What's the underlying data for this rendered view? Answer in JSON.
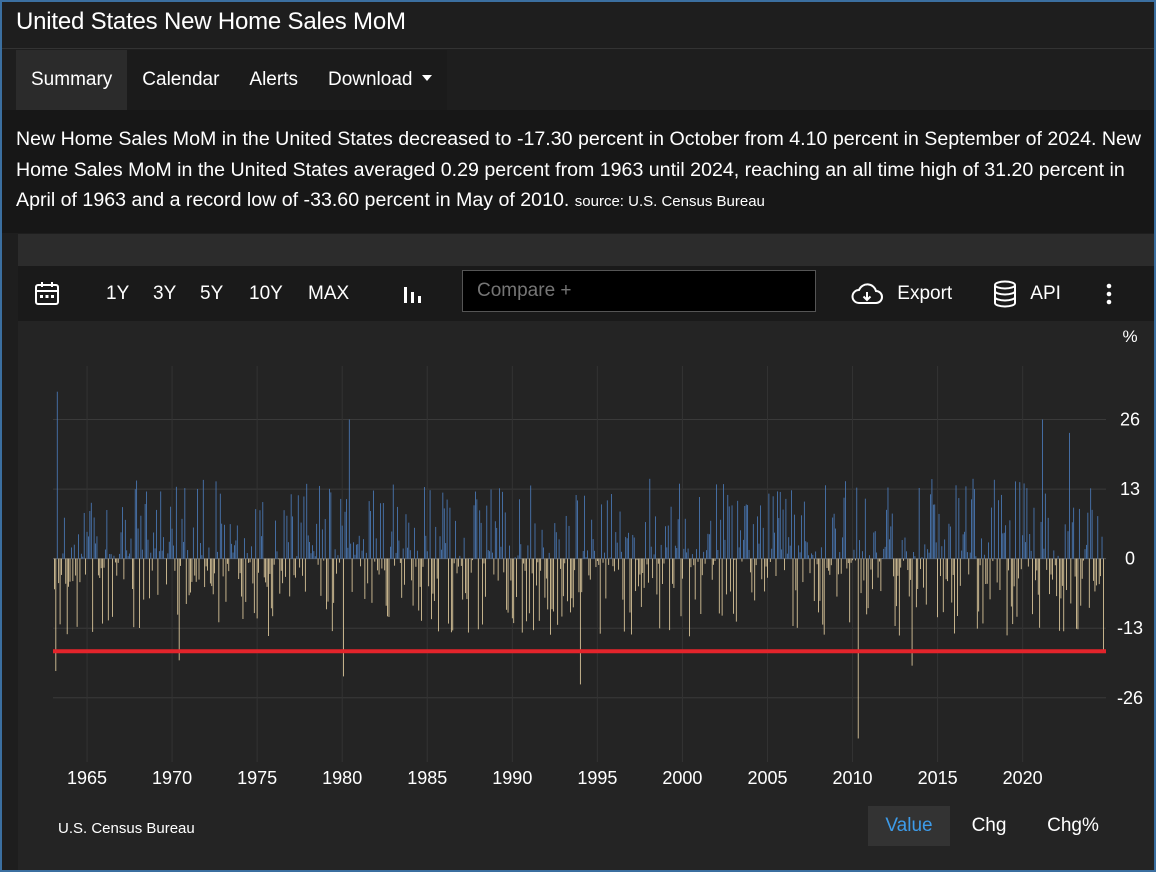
{
  "header": {
    "title": "United States New Home Sales MoM"
  },
  "tabs": [
    {
      "label": "Summary"
    },
    {
      "label": "Calendar"
    },
    {
      "label": "Alerts"
    },
    {
      "label": "Download"
    }
  ],
  "description": {
    "text": "New Home Sales MoM in the United States decreased to -17.30 percent in October from 4.10 percent in September of 2024. New Home Sales MoM in the United States averaged 0.29 percent from 1963 until 2024, reaching an all time high of 31.20 percent in April of 1963 and a record low of -33.60 percent in May of 2010.",
    "source": "source: U.S. Census Bureau"
  },
  "toolbar": {
    "ranges": [
      "1Y",
      "3Y",
      "5Y",
      "10Y",
      "MAX"
    ],
    "compare_placeholder": "Compare +",
    "export_label": "Export",
    "api_label": "API"
  },
  "chart_footer": {
    "source": "U.S. Census Bureau",
    "buttons": [
      "Value",
      "Chg",
      "Chg%"
    ],
    "active": "Value"
  },
  "colors": {
    "positive": "#4e81c4",
    "negative": "#f0d9a8",
    "reference_line": "#e3242b",
    "accent": "#3d9be9"
  },
  "chart_data": {
    "type": "bar",
    "unit_label": "%",
    "x_ticks": [
      "1965",
      "1970",
      "1975",
      "1980",
      "1985",
      "1990",
      "1995",
      "2000",
      "2005",
      "2010",
      "2015",
      "2020"
    ],
    "y_ticks": [
      26,
      13,
      0,
      -13,
      -26
    ],
    "ylim": [
      -38,
      36
    ],
    "xlim": [
      1963.0,
      2024.9
    ],
    "reference_line": -17.3,
    "grid": true,
    "notable_points": [
      {
        "date": "1963-04",
        "value": 31.2
      },
      {
        "date": "1963-03",
        "value": -21.0
      },
      {
        "date": "1970-06",
        "value": -19.0
      },
      {
        "date": "1980-06",
        "value": 26.0
      },
      {
        "date": "1980-02",
        "value": -22.0
      },
      {
        "date": "1994-01",
        "value": -23.5
      },
      {
        "date": "2010-05",
        "value": -33.6
      },
      {
        "date": "2013-07",
        "value": -20.0
      },
      {
        "date": "2021-03",
        "value": 26.0
      },
      {
        "date": "2022-10",
        "value": 23.5
      },
      {
        "date": "2024-09",
        "value": 4.1
      },
      {
        "date": "2024-10",
        "value": -17.3
      }
    ]
  }
}
